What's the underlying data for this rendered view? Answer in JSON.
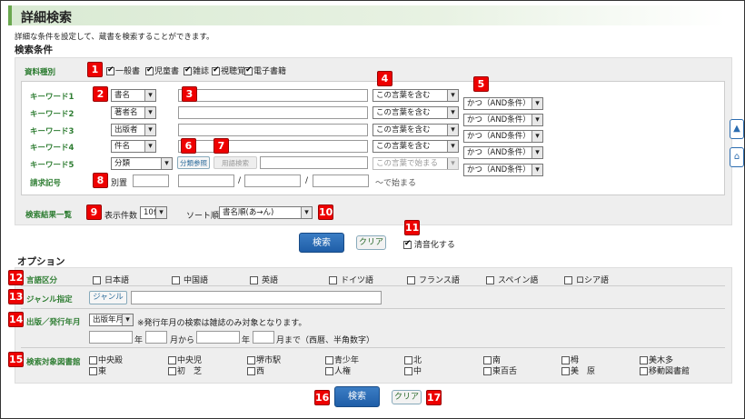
{
  "page": {
    "title": "詳細検索",
    "description": "詳細な条件を設定して、蔵書を検索することができます。"
  },
  "conditions": {
    "heading": "検索条件",
    "material_label": "資料種別",
    "materials": [
      {
        "label": "一般書",
        "checked": true
      },
      {
        "label": "児童書",
        "checked": true
      },
      {
        "label": "雑誌",
        "checked": true
      },
      {
        "label": "視聴覚",
        "checked": true
      },
      {
        "label": "電子書籍",
        "checked": true
      }
    ],
    "keywords": [
      {
        "label": "キーワード1",
        "field": "書名",
        "match": "この言葉を含む"
      },
      {
        "label": "キーワード2",
        "field": "著者名",
        "match": "この言葉を含む"
      },
      {
        "label": "キーワード3",
        "field": "出版者",
        "match": "この言葉を含む"
      },
      {
        "label": "キーワード4",
        "field": "件名",
        "match": "この言葉を含む"
      },
      {
        "label": "キーワード5",
        "field": "分類",
        "match": "この言葉で始まる"
      }
    ],
    "andor": [
      "かつ（AND条件）",
      "かつ（AND条件）",
      "かつ（AND条件）",
      "かつ（AND条件）",
      "かつ（AND条件）"
    ],
    "bunrui_ref_button": "分類参照",
    "term_search_button": "用語検索",
    "call_label": "請求記号",
    "call_sub": "別置",
    "call_sep1": "/",
    "call_sep2": "/",
    "call_suffix": "～で始まる"
  },
  "results": {
    "label": "検索結果一覧",
    "count_label": "表示件数",
    "count_value": "10件",
    "sort_label": "ソート順",
    "sort_value": "書名順(あ→ん)"
  },
  "actions": {
    "search": "検索",
    "clear": "クリア",
    "normalize_label": "清音化する",
    "normalize_checked": true
  },
  "options": {
    "heading": "オプション",
    "lang_label": "言語区分",
    "languages": [
      "日本語",
      "中国語",
      "英語",
      "ドイツ語",
      "フランス語",
      "スペイン語",
      "ロシア語"
    ],
    "genre_label": "ジャンル指定",
    "genre_button": "ジャンル",
    "pub_label": "出版／発行年月",
    "pub_select": "出版年月",
    "pub_note": "※発行年月の検索は雑誌のみ対象となります。",
    "year1": "年",
    "month_from": "月から",
    "year2": "年",
    "month_to": "月まで（西暦、半角数字）",
    "lib_label": "検索対象図書館",
    "libraries_row1": [
      "中央殿",
      "中央児",
      "堺市駅",
      "青少年",
      "北",
      "南",
      "栂",
      "美木多"
    ],
    "libraries_row2": [
      "東",
      "初　芝",
      "西",
      "人権",
      "中",
      "東百舌",
      "美　原",
      "移動図書館"
    ]
  },
  "badges": [
    "1",
    "2",
    "3",
    "4",
    "5",
    "6",
    "7",
    "8",
    "9",
    "10",
    "11",
    "12",
    "13",
    "14",
    "15",
    "16",
    "17"
  ],
  "side": {
    "top_icon": "to-top-icon",
    "home_icon": "home-icon"
  }
}
